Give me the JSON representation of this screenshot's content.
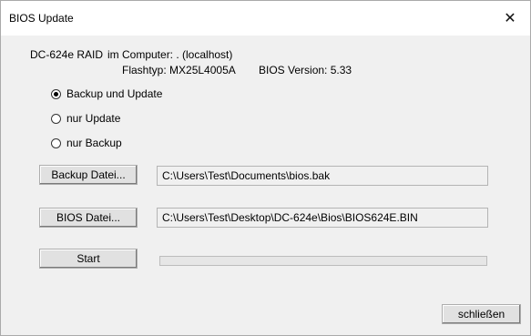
{
  "window": {
    "title": "BIOS Update",
    "close_icon": "close-icon",
    "close_glyph": "✕"
  },
  "info": {
    "device": "DC-624e RAID",
    "computer": "im Computer: . (localhost)",
    "flash": "Flashtyp: MX25L4005A",
    "bios": "BIOS Version: 5.33"
  },
  "options": [
    {
      "label": "Backup und Update",
      "checked": true
    },
    {
      "label": "nur Update",
      "checked": false
    },
    {
      "label": "nur Backup",
      "checked": false
    }
  ],
  "backup": {
    "button": "Backup Datei...",
    "path": "C:\\Users\\Test\\Documents\\bios.bak"
  },
  "bios_file": {
    "button": "BIOS Datei...",
    "path": "C:\\Users\\Test\\Desktop\\DC-624e\\Bios\\BIOS624E.BIN"
  },
  "start": {
    "button": "Start",
    "progress": 0
  },
  "close_button": "schließen"
}
